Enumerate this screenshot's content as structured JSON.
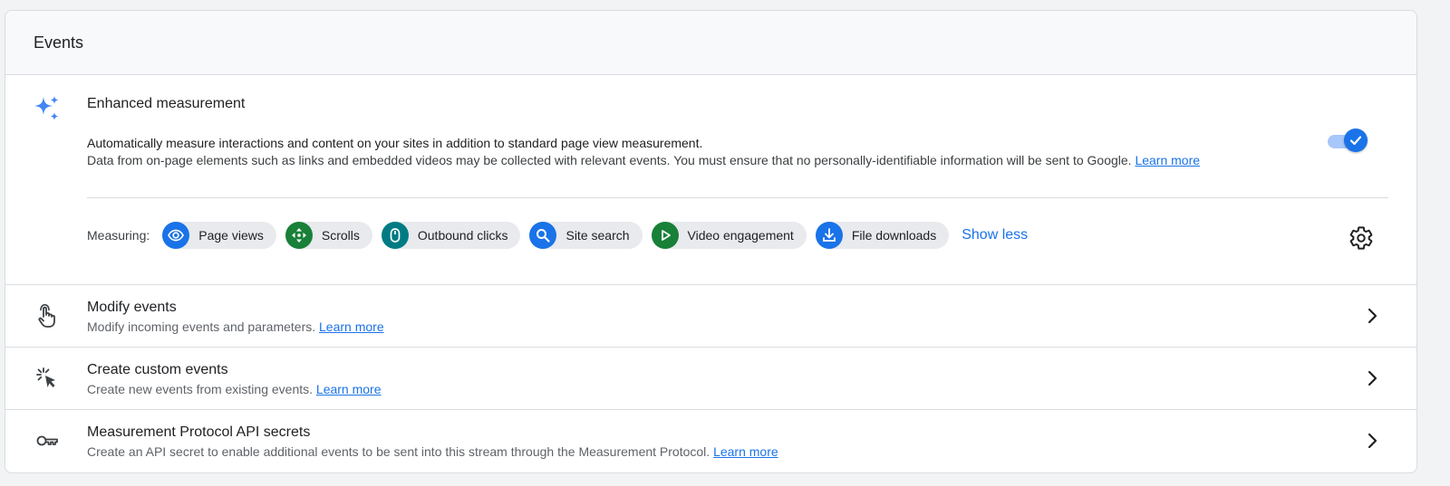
{
  "header": {
    "title": "Events"
  },
  "enhanced": {
    "title": "Enhanced measurement",
    "desc_line1": "Automatically measure interactions and content on your sites in addition to standard page view measurement.",
    "desc_line2": "Data from on-page elements such as links and embedded videos may be collected with relevant events. You must ensure that no personally-identifiable information will be sent to Google.",
    "learn_more": "Learn more",
    "toggle_on": true,
    "measuring_label": "Measuring:",
    "chips": [
      {
        "label": "Page views",
        "icon": "eye-icon",
        "color": "#1a73e8"
      },
      {
        "label": "Scrolls",
        "icon": "scroll-arrows-icon",
        "color": "#188038"
      },
      {
        "label": "Outbound clicks",
        "icon": "mouse-icon",
        "color": "#007b83"
      },
      {
        "label": "Site search",
        "icon": "search-icon",
        "color": "#1a73e8"
      },
      {
        "label": "Video engagement",
        "icon": "play-icon",
        "color": "#188038"
      },
      {
        "label": "File downloads",
        "icon": "download-icon",
        "color": "#1a73e8"
      }
    ],
    "show_less": "Show less",
    "settings_icon": "gear-icon"
  },
  "rows": [
    {
      "title": "Modify events",
      "subtitle": "Modify incoming events and parameters.",
      "learn_more": "Learn more",
      "icon": "touch-hand-icon"
    },
    {
      "title": "Create custom events",
      "subtitle": "Create new events from existing events.",
      "learn_more": "Learn more",
      "icon": "click-cursor-icon"
    },
    {
      "title": "Measurement Protocol API secrets",
      "subtitle": "Create an API secret to enable additional events to be sent into this stream through the Measurement Protocol.",
      "learn_more": "Learn more",
      "icon": "key-icon"
    }
  ],
  "colors": {
    "accent": "#1a73e8",
    "toggle_track": "#a8c7fa",
    "chip_bg": "#e8eaed"
  }
}
